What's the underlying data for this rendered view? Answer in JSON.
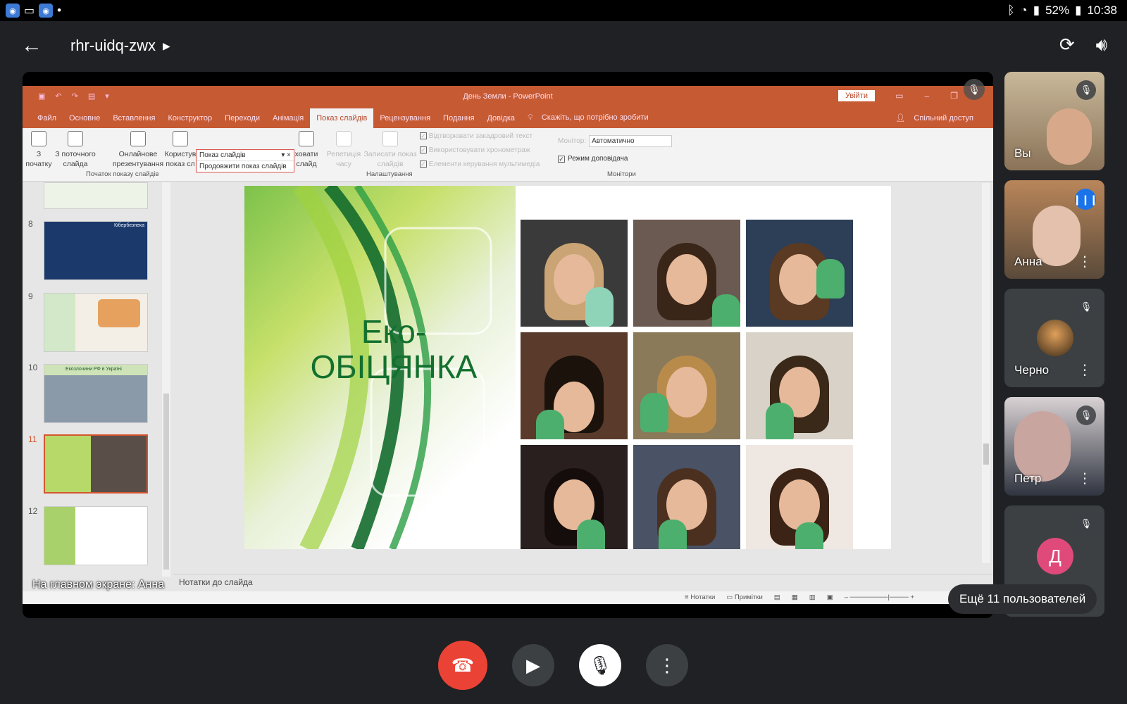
{
  "statusbar": {
    "battery": "52%",
    "time": "10:38"
  },
  "meeting": {
    "code": "rhr-uidq-zwx"
  },
  "ppt": {
    "window_title": "День Земли  -  PowerPoint",
    "login": "Увійти",
    "tabs": [
      "Файл",
      "Основне",
      "Вставлення",
      "Конструктор",
      "Переходи",
      "Анімація",
      "Показ слайдів",
      "Рецензування",
      "Подання",
      "Довідка"
    ],
    "tell_me": "Скажіть, що потрібно зробити",
    "share": "Спільний доступ",
    "ribbon": {
      "from_start": "З початку",
      "from_current": "З поточного слайда",
      "online": "Онлайнове презентування",
      "custom": "Користув показ сл",
      "hide": "ховати слайд",
      "rehearse": "Репетиція часу",
      "record": "Записати показ слайдів",
      "group_start": "Початок показу слайдів",
      "group_setup": "Налаштування",
      "group_monitors": "Монітори",
      "check1": "Відтворювати закадровий текст",
      "check2": "Використовувати хронометраж",
      "check3": "Елементи керування мультимедіа",
      "monitor_label": "Монітор:",
      "monitor_value": "Автоматично",
      "presenter_view": "Режим доповідача"
    },
    "dropdown": {
      "title": "Показ слайдів",
      "item": "Продовжити показ слайдів"
    },
    "thumb_numbers": [
      "8",
      "9",
      "10",
      "11",
      "12"
    ],
    "thumb_captions": [
      "Кібербезпека",
      "Екозлочини РФ в Україні"
    ],
    "slide_title": "Еко-ОБІЦЯНКА",
    "notes": "Нотатки до слайда",
    "status_notes": "Нотатки",
    "status_comments": "Примітки"
  },
  "presenting": "На главном экране: Анна",
  "participants": [
    {
      "name": "Вы"
    },
    {
      "name": "Анна"
    },
    {
      "name": "Черно"
    },
    {
      "name": "Петр"
    },
    {
      "name": "",
      "initial": "Д"
    }
  ],
  "more_users": "Ещё 11 пользователей",
  "colors": {
    "end_call": "#ea4335",
    "ppt_orange": "#c55a33",
    "slide_green": "#13702e"
  }
}
